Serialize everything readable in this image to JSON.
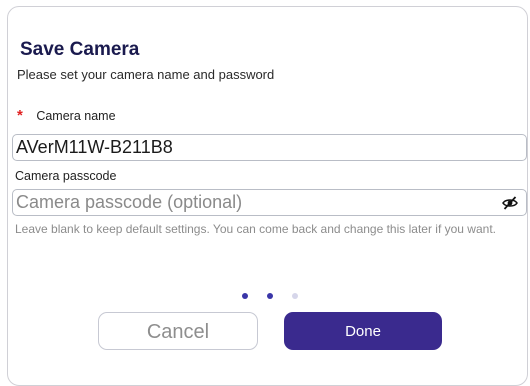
{
  "dialog": {
    "title": "Save Camera",
    "subtitle": "Please set your camera name and password",
    "required_marker": "*",
    "camera_name_label": "Camera name",
    "camera_name_value": "AVerM11W-B211B8",
    "passcode_label": "Camera passcode",
    "passcode_placeholder": "Camera passcode (optional)",
    "passcode_value": "",
    "passcode_visibility_icon": "eye-slash-icon",
    "hint": "Leave blank to keep default settings. You can come back and change this later if you want.",
    "steps": {
      "total": 3,
      "current": 2
    },
    "cancel_label": "Cancel",
    "done_label": "Done"
  },
  "colors": {
    "title": "#1a1a4e",
    "required": "#e02020",
    "primary": "#3a2a8e",
    "dot_active": "#3a36a8",
    "dot_inactive": "#d6d6ea",
    "hint": "#8c8c8c"
  }
}
